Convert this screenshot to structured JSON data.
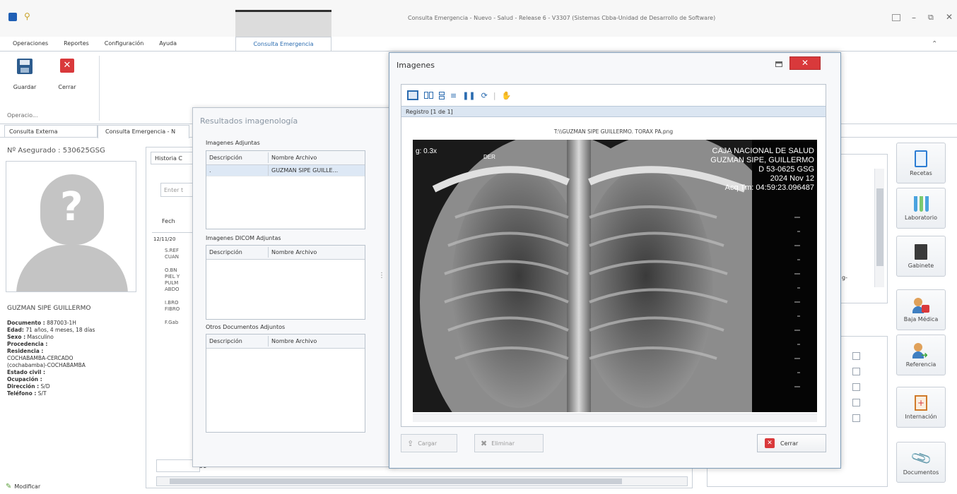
{
  "window": {
    "title": "Consulta Emergencia - Nuevo - Salud - Release 6 - V3307 (Sistemas Cbba-Unidad de Desarrollo de Software)"
  },
  "menu": {
    "items": [
      "Operaciones",
      "Reportes",
      "Configuración",
      "Ayuda"
    ],
    "active_tab": "Consulta Emergencia"
  },
  "ribbon": {
    "save_label": "Guardar",
    "close_label": "Cerrar",
    "group_label": "Operacio..."
  },
  "doc_tabs": [
    "Consulta Externa",
    "Consulta Emergencia - N"
  ],
  "patient": {
    "insured_no": "Nº Asegurado : 530625GSG",
    "name": "GUZMAN SIPE GUILLERMO",
    "documento_label": "Documento :",
    "documento": "887003-1H",
    "edad_label": "Edad:",
    "edad": "71 años, 4 meses, 18 días",
    "sexo_label": "Sexo :",
    "sexo": "Masculino",
    "procedencia_label": "Procedencia :",
    "residencia_label": "Residencia :",
    "residencia_1": "COCHABAMBA-CERCADO",
    "residencia_2": "(cochabamba)-COCHABAMBA",
    "estado_civil_label": "Estado civil :",
    "ocupacion_label": "Ocupación :",
    "direccion_label": "Dirección :",
    "direccion": "S/D",
    "telefono_label": "Teléfono :",
    "telefono": "S/T",
    "modify_label": "Modificar"
  },
  "history": {
    "tab": "Historia C",
    "filter_placeholder": "Enter t",
    "column": "Fech",
    "date": "12/11/20",
    "lines": [
      "S.REF",
      "CUAN",
      "O.BN",
      "PIEL Y",
      "PULM",
      "ABDO",
      "I.BRO",
      "FIBRO",
      "F.Gab"
    ],
    "footer_value": "51"
  },
  "results": {
    "title": "Resultados imagenología",
    "images_label": "Imagenes Adjuntas",
    "col_desc": "Descripción",
    "col_file": "Nombre Archivo",
    "images_rows": [
      {
        "desc": ".",
        "file": "GUZMAN SIPE GUILLE..."
      }
    ],
    "dicom_label": "Imagenes DICOM Adjuntas",
    "others_label": "Otros Documentos Adjuntos"
  },
  "viewer": {
    "title": "Imagenes",
    "record_label": "Registro [1 de 1]",
    "file_path": "T:\\\\GUZMAN SIPE GUILLERMO. TORAX PA.png",
    "load_label": "Cargar",
    "delete_label": "Eliminar",
    "close_label": "Cerrar"
  },
  "xray": {
    "zoom": "g: 0.3x",
    "side_marker": "DER",
    "institution": "CAJA NACIONAL DE SALUD",
    "patient": "GUZMAN SIPE, GUILLERMO",
    "id": "D 53-0625 GSG",
    "date": "2024 Nov 12",
    "time": "Acq Tm: 04:59:23.096487"
  },
  "right_panel": {
    "fragment": "g-"
  },
  "side_buttons": [
    "Recetas",
    "Laboratorio",
    "Gabinete",
    "Baja Médica",
    "Referencia",
    "Internación",
    "Documentos"
  ],
  "colors": {
    "accent": "#2b6cb0",
    "title_bar": "#f0f0f0",
    "xray_bg": "#111111"
  }
}
